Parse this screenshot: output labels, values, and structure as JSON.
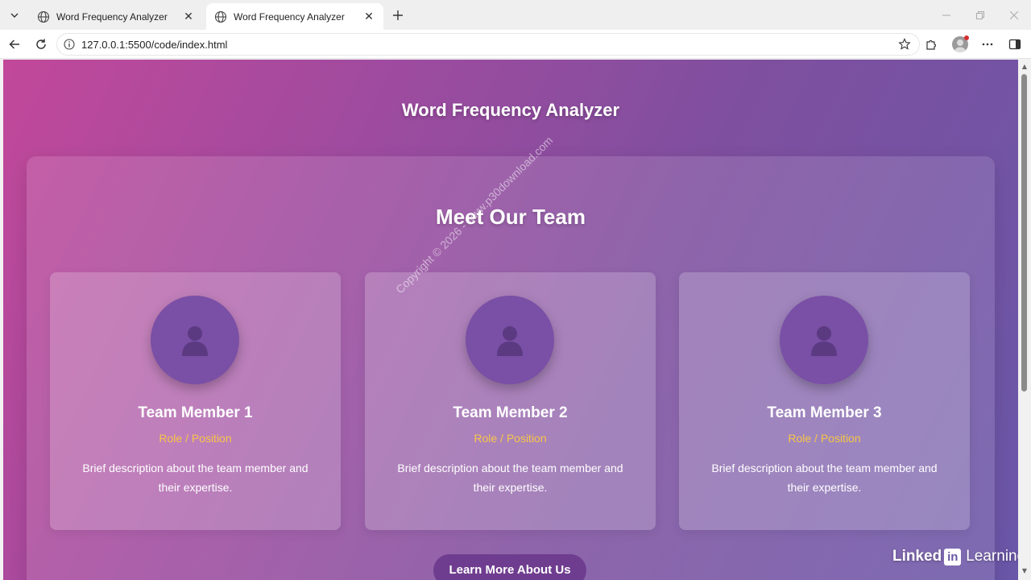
{
  "browser": {
    "tabs": [
      {
        "title": "Word Frequency Analyzer",
        "active": false
      },
      {
        "title": "Word Frequency Analyzer",
        "active": true
      }
    ],
    "url": "127.0.0.1:5500/code/index.html"
  },
  "page": {
    "title": "Word Frequency Analyzer",
    "section_title": "Meet Our Team",
    "members": [
      {
        "name": "Team Member 1",
        "role": "Role / Position",
        "description": "Brief description about the team member and their expertise."
      },
      {
        "name": "Team Member 2",
        "role": "Role / Position",
        "description": "Brief description about the team member and their expertise."
      },
      {
        "name": "Team Member 3",
        "role": "Role / Position",
        "description": "Brief description about the team member and their expertise."
      }
    ],
    "cta_label": "Learn More About Us"
  },
  "overlays": {
    "watermark": "Copyright © 2026 - www.p30download.com",
    "linkedin_brand": "Linked",
    "linkedin_in": "in",
    "linkedin_learning": "Learning"
  },
  "colors": {
    "gradient_start": "#c2489a",
    "gradient_end": "#6a57a8",
    "role_accent": "#f7c548",
    "photo_circle": "#7a4fa6",
    "cta_bg": "#6f3d8f"
  },
  "icons": {
    "tab_menu": "chevron-down-icon",
    "tab_favicon": "globe-icon",
    "tab_close": "close-icon",
    "new_tab": "plus-icon",
    "back": "back-arrow-icon",
    "reload": "reload-icon",
    "site_info": "info-icon",
    "favorite": "star-icon",
    "extensions": "puzzle-icon",
    "profile": "avatar",
    "menu": "more-dots-icon",
    "sidebar": "sidebar-icon",
    "member_photo": "person-icon"
  }
}
